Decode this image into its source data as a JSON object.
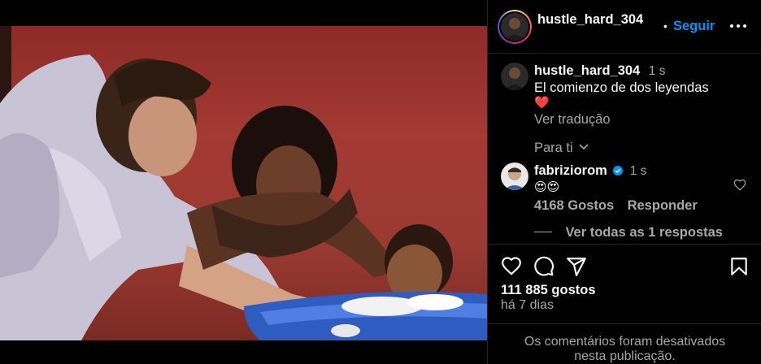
{
  "post": {
    "author": "hustle_hard_304",
    "follow_label": "Seguir",
    "separator": "•"
  },
  "caption": {
    "username": "hustle_hard_304",
    "time": "1 s",
    "text": "El comienzo de dos leyendas",
    "emoji": "❤️",
    "translate_label": "Ver tradução",
    "for_you_label": "Para ti"
  },
  "comments": [
    {
      "username": "fabriziorom",
      "verified": true,
      "time": "1 s",
      "text": "😍😍",
      "likes_label": "4168 Gostos",
      "reply_label": "Responder",
      "view_replies_label": "Ver todas as 1 respostas"
    }
  ],
  "stats": {
    "likes": "111 885 gostos",
    "posted_ago": "há 7 dias"
  },
  "footer": {
    "comments_disabled_line1": "Os comentários foram desativados",
    "comments_disabled_line2": "nesta publicação."
  },
  "icons": {
    "like": "heart-icon",
    "comment": "comment-icon",
    "share": "share-icon",
    "save": "bookmark-icon",
    "more": "more-icon",
    "verified": "verified-badge-icon"
  },
  "colors": {
    "background": "#000000",
    "text": "#f5f5f5",
    "secondary": "#a8a8a8",
    "accent": "#0095f6",
    "divider": "#262626"
  }
}
